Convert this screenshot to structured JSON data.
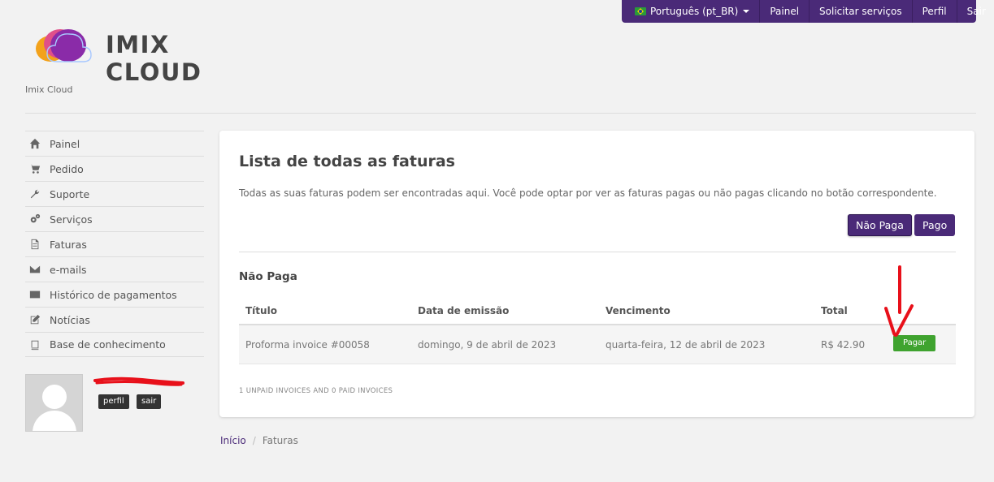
{
  "topnav": {
    "language": "Português (pt_BR)",
    "items": [
      "Painel",
      "Solicitar serviços",
      "Perfil",
      "Sair"
    ]
  },
  "brand": {
    "logo_text": "IMIX CLOUD",
    "subtitle": "Imix Cloud",
    "colors": [
      "#f3a21b",
      "#d63384",
      "#6f2da8"
    ]
  },
  "sidebar": {
    "items": [
      {
        "label": "Painel",
        "icon": "home-icon"
      },
      {
        "label": "Pedido",
        "icon": "cart-icon"
      },
      {
        "label": "Suporte",
        "icon": "wrench-icon"
      },
      {
        "label": "Serviços",
        "icon": "gears-icon"
      },
      {
        "label": "Faturas",
        "icon": "file-icon"
      },
      {
        "label": "e-mails",
        "icon": "envelope-icon"
      },
      {
        "label": "Histórico de pagamentos",
        "icon": "credit-card-icon"
      },
      {
        "label": "Notícias",
        "icon": "edit-icon"
      },
      {
        "label": "Base de conhecimento",
        "icon": "book-icon"
      }
    ]
  },
  "user": {
    "profile_label": "perfil",
    "logout_label": "sair"
  },
  "main": {
    "title": "Lista de todas as faturas",
    "description": "Todas as suas faturas podem ser encontradas aqui. Você pode optar por ver as faturas pagas ou não pagas clicando no botão correspondente.",
    "filter_unpaid": "Não Paga",
    "filter_paid": "Pago",
    "section_title": "Não Paga",
    "table": {
      "headers": [
        "Título",
        "Data de emissão",
        "Vencimento",
        "Total"
      ],
      "rows": [
        {
          "title": "Proforma invoice #00058",
          "issued": "domingo, 9 de abril de 2023",
          "due": "quarta-feira, 12 de abril de 2023",
          "total": "R$ 42.90",
          "action": "Pagar"
        }
      ]
    },
    "summary": "1 UNPAID INVOICES AND 0 PAID INVOICES"
  },
  "breadcrumb": {
    "home": "Início",
    "current": "Faturas"
  },
  "theme": {
    "accent": "#4a2a78",
    "pay_button": "#3fa32f",
    "annotation": "#e8101a"
  }
}
